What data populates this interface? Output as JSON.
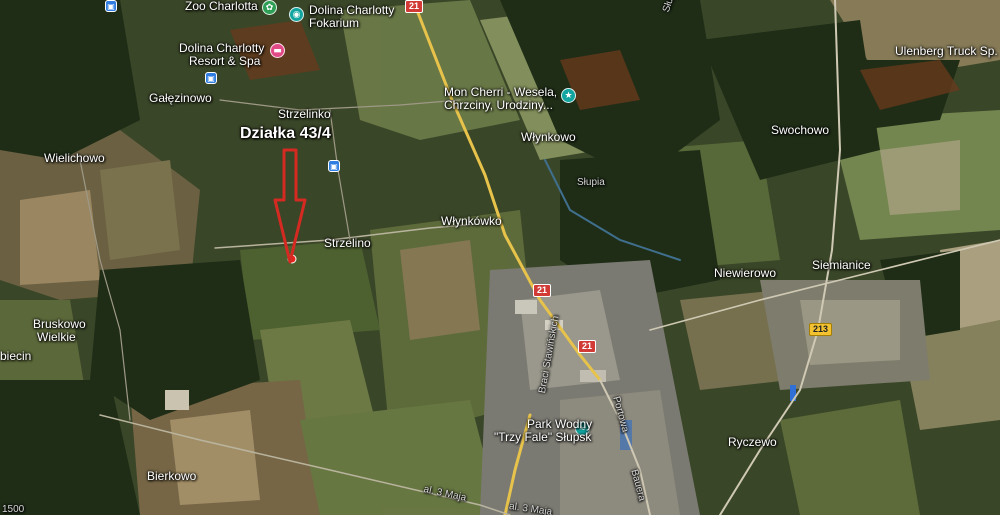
{
  "map": {
    "plot_label": "Działka 43/4",
    "places": {
      "zoo": "Zoo Charlotta",
      "fokarium_line1": "Dolina Charlotty",
      "fokarium_line2": "Fokarium",
      "resort_line1": "Dolina Charlotty",
      "resort_line2": "Resort & Spa",
      "galezinowo": "Gałęzinowo",
      "strzelinko": "Strzelinko",
      "mon_cherri_line1": "Mon Cherri - Wesela,",
      "mon_cherri_line2": "Chrzciny, Urodziny...",
      "wlynkowo": "Włynkowo",
      "ulenberg": "Ulenberg Truck Sp.",
      "swochowo": "Swochowo",
      "wielichowo": "Wielichowo",
      "slupia": "Słupia",
      "sypia_road": "Słupia",
      "wlynkowko": "Włynkówko",
      "strzelino": "Strzelino",
      "niewierowo": "Niewierowo",
      "siemianice": "Siemianice",
      "bruskowo_line1": "Bruskowo",
      "bruskowo_line2": "Wielkie",
      "biecin": "biecin",
      "park_line1": "Park Wodny",
      "park_line2": "\"Trzy Fale\" Słupsk",
      "ryczewo": "Ryczewo",
      "bierkowo": "Bierkowo",
      "braci_street": "Braci Stawińskich",
      "portowa": "Portowa",
      "bauera": "Bauera",
      "maja_1": "al. 3 Maja",
      "maja_2": "al. 3 Maja"
    },
    "roads": {
      "r21_top": "21",
      "r21_mid": "21",
      "r21_low": "21",
      "r213": "213"
    },
    "scale_text": "1500",
    "icons": {
      "zoo": "paw-icon",
      "fokarium": "camera-icon",
      "resort": "hotel-icon",
      "mon_cherri": "event-venue-icon",
      "park": "water-park-icon",
      "bus": "bus-stop-icon",
      "parcel_pin": "location-dot-icon",
      "plot_arrow": "down-arrow-icon"
    },
    "colors": {
      "arrow": "#d42a22",
      "pin": "#e8261d",
      "road_major": "#e7c34b",
      "poi_teal": "#12a5a0",
      "poi_pink": "#e24a86",
      "shield_red": "#d23b35",
      "shield_yellow": "#f2c230",
      "bus": "#2f7de1"
    }
  }
}
